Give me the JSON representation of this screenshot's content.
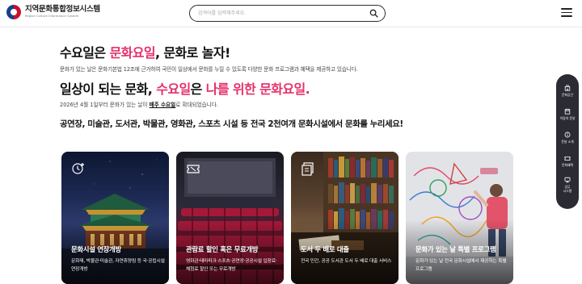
{
  "header": {
    "logo_title": "지역문화통합정보시스템",
    "logo_subtitle": "Region Culture Information System",
    "search_placeholder": "검색어를 입력해주세요.",
    "search_value": ""
  },
  "main": {
    "h1_part1": "수요일은 ",
    "h1_highlight": "문화요일",
    "h1_part2": ", 문화로 놀자!",
    "description": "문화가 있는 날은 문화기본법 12조에 근거하여 국민이 일상에서 문화를 누릴 수 있도록 다양한 문화 프로그램과 혜택을 제공하고 있습니다.",
    "h2_part1": "일상이 되는 문화, ",
    "h2_highlight1": "수요일",
    "h2_part2": "은 ",
    "h2_highlight2": "나를 위한 문화요일.",
    "date_prefix": "2026년 4월 1일부터 문화가 있는 날이 ",
    "date_link": "매주 수요일",
    "date_suffix": "로 확대되었습니다.",
    "h3": "공연장, 미술관, 도서관, 박물관, 영화관, 스포츠 시설 등 전국 2천여개 문화시설에서 문화를 누리세요!"
  },
  "cards": [
    {
      "icon": "clock-plus-icon",
      "title": "문화시설 연장개방",
      "desc": "문화재, 박물관·미술관, 자연휴양림 등 국·공립시설 연장개방"
    },
    {
      "icon": "ticket-icon",
      "title": "관람료 할인 혹은 무료개방",
      "desc": "영화관·테마파크·스포츠·공연장·공공시설 입장료·체험료 할인 또는 무료개방"
    },
    {
      "icon": "book-icon",
      "title": "도서 두 배로 대출",
      "desc": "전국 민간, 공공 도서관 도서 두 배로 대출 서비스"
    },
    {
      "icon": "star-icon",
      "title": "문화가 있는 날 특별 프로그램",
      "desc": "문화가 있는 날 전국 문화시설에서 제공하는 특별 프로그램"
    }
  ],
  "quick_menu": [
    {
      "icon": "building-icon",
      "label": "문화공간"
    },
    {
      "icon": "calendar-icon",
      "label": "이달의 문날"
    },
    {
      "icon": "info-icon",
      "label": "문날 소개"
    },
    {
      "icon": "ticket-icon",
      "label": "문화혜택"
    },
    {
      "icon": "monitor-icon",
      "label": "업무",
      "label2": "시스템"
    }
  ],
  "colors": {
    "accent": "#e5306a",
    "quick_menu_bg": "#2b2b33"
  }
}
